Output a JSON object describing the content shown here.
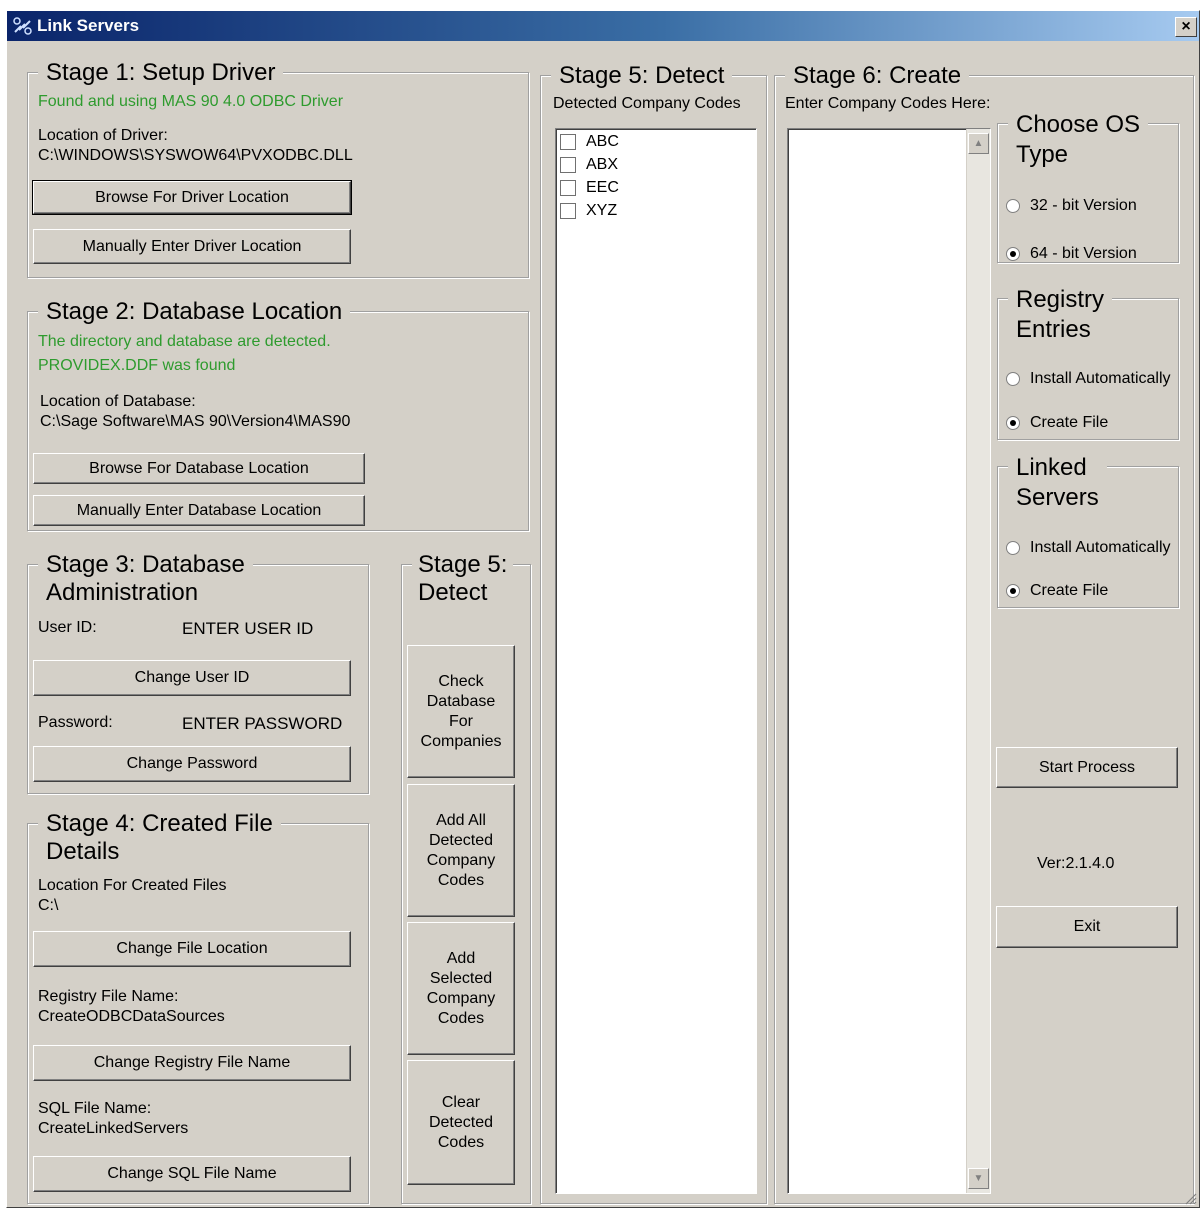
{
  "window": {
    "title": "Link Servers",
    "close_label": "×"
  },
  "stage1": {
    "title": "Stage 1: Setup Driver",
    "status": "Found and using MAS 90 4.0 ODBC Driver",
    "location_label": "Location of Driver:",
    "location_value": "C:\\WINDOWS\\SYSWOW64\\PVXODBC.DLL",
    "browse_button": "Browse For Driver Location",
    "manual_button": "Manually Enter Driver Location"
  },
  "stage2": {
    "title": "Stage 2: Database Location",
    "status_line1": "The directory and database are detected.",
    "status_line2": "PROVIDEX.DDF was found",
    "location_label": "Location of Database:",
    "location_value": "C:\\Sage Software\\MAS 90\\Version4\\MAS90",
    "browse_button": "Browse For Database Location",
    "manual_button": "Manually Enter Database Location"
  },
  "stage3": {
    "title": "Stage 3: Database\nAdministration",
    "user_label": "User ID:",
    "user_value": "ENTER USER ID",
    "change_user_button": "Change User ID",
    "password_label": "Password:",
    "password_value": "ENTER PASSWORD",
    "change_password_button": "Change Password"
  },
  "stage4": {
    "title": "Stage 4: Created File\nDetails",
    "location_label": "Location For Created Files",
    "location_value": "C:\\",
    "change_location_button": "Change File Location",
    "registry_label": "Registry File Name:",
    "registry_value": "CreateODBCDataSources",
    "change_registry_button": "Change Registry File Name",
    "sql_label": "SQL File Name:",
    "sql_value": "CreateLinkedServers",
    "change_sql_button": "Change SQL File Name"
  },
  "stage5_actions": {
    "title": "Stage 5:\nDetect",
    "check_button": "Check\nDatabase\nFor\nCompanies",
    "add_all_button": "Add All\nDetected\nCompany\nCodes",
    "add_selected_button": "Add\nSelected\nCompany\nCodes",
    "clear_button": "Clear\nDetected\nCodes"
  },
  "stage5_detect": {
    "title": "Stage 5: Detect",
    "subtitle": "Detected Company Codes",
    "codes": [
      {
        "label": "ABC",
        "checked": false
      },
      {
        "label": "ABX",
        "checked": false
      },
      {
        "label": "EEC",
        "checked": false
      },
      {
        "label": "XYZ",
        "checked": false
      }
    ]
  },
  "stage6": {
    "title": "Stage 6: Create",
    "subtitle": "Enter Company Codes Here:",
    "os_type": {
      "title": "Choose OS\nType",
      "options": [
        "32 - bit Version",
        "64 - bit Version"
      ],
      "selected": "64 - bit Version"
    },
    "registry": {
      "title": "Registry\nEntries",
      "options": [
        "Install Automatically",
        "Create File"
      ],
      "selected": "Create File"
    },
    "linked": {
      "title": "Linked\nServers",
      "options": [
        "Install Automatically",
        "Create File"
      ],
      "selected": "Create File"
    },
    "start_button": "Start Process",
    "version": "Ver:2.1.4.0",
    "exit_button": "Exit"
  },
  "icons": {
    "app": "link-servers-app-icon",
    "scroll_up": "scroll-up-arrow-icon",
    "scroll_down": "scroll-down-arrow-icon"
  },
  "colors": {
    "status_green": "#2e9b2e",
    "face": "#d4d0c8",
    "title_start": "#0a246a",
    "title_end": "#a6caf0"
  }
}
